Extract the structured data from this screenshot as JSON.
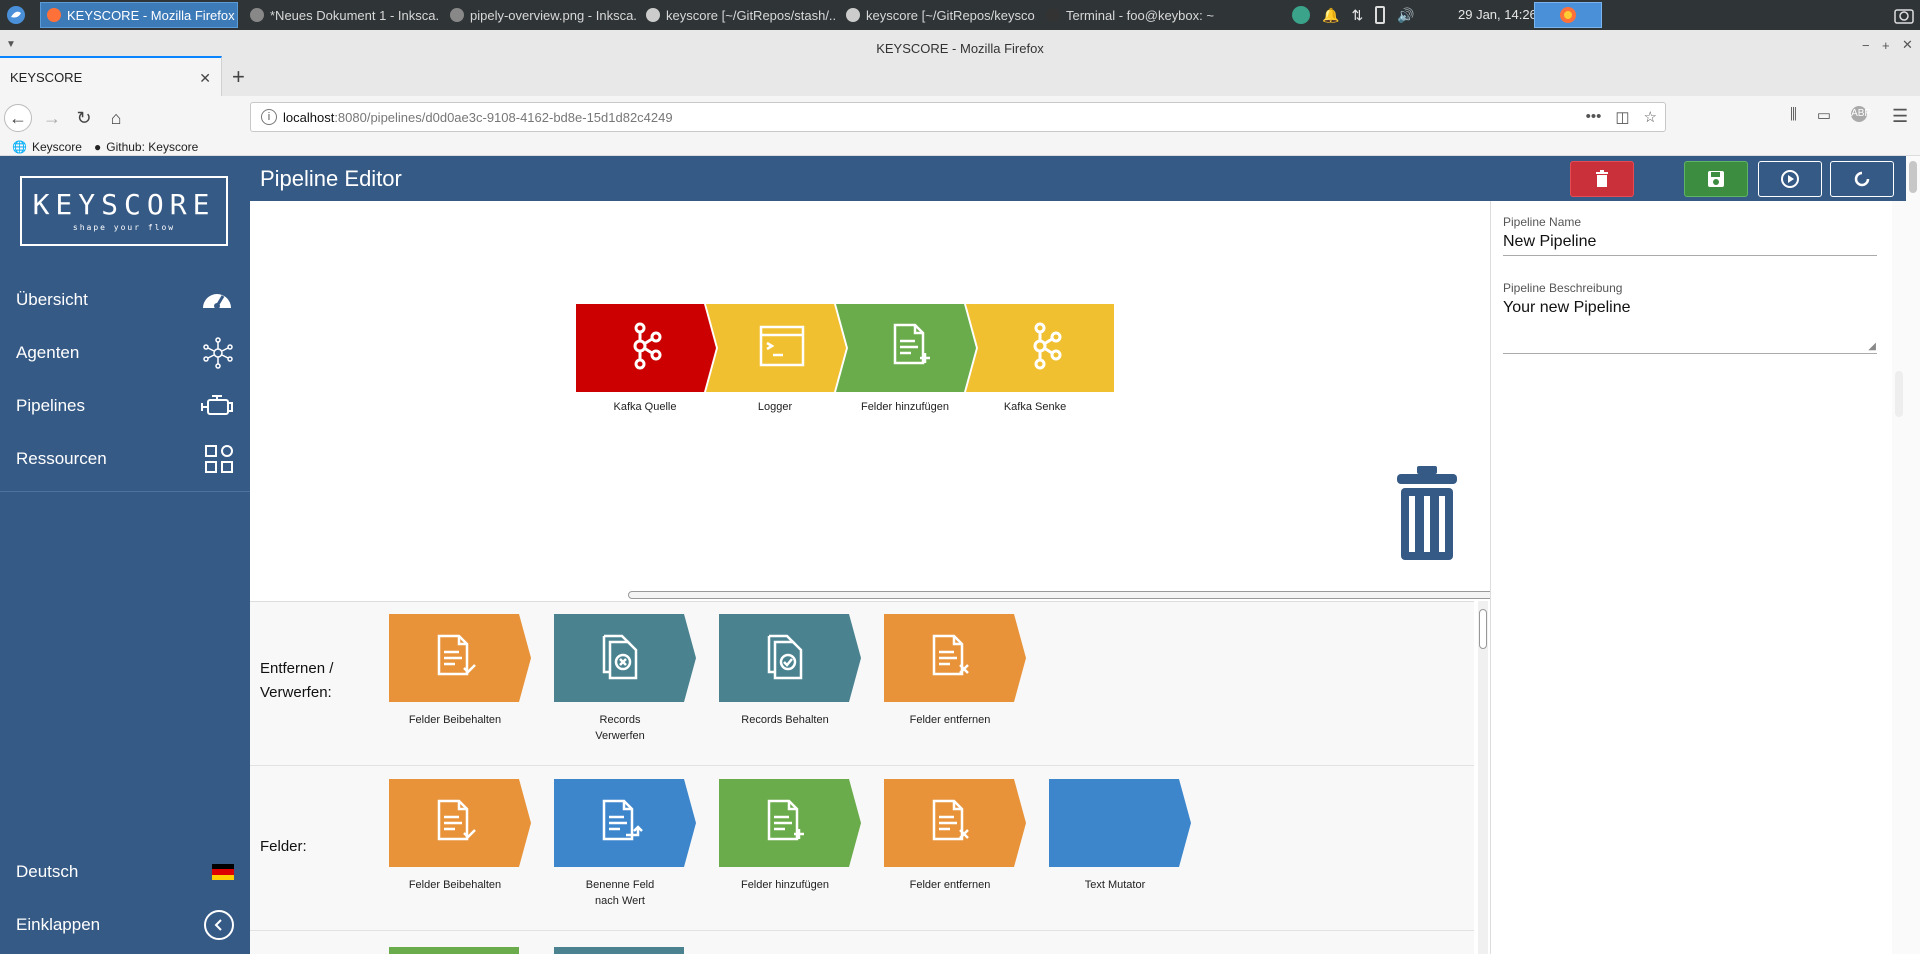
{
  "taskbar": {
    "windows": [
      {
        "label": "KEYSCORE - Mozilla Firefox",
        "active": true
      },
      {
        "label": "*Neues Dokument 1 - Inksca...",
        "active": false
      },
      {
        "label": "pipely-overview.png - Inksca...",
        "active": false
      },
      {
        "label": "keyscore [~/GitRepos/stash/...",
        "active": false
      },
      {
        "label": "keyscore [~/GitRepos/keysco...",
        "active": false
      },
      {
        "label": "Terminal - foo@keybox: ~",
        "active": false
      }
    ],
    "clock": "29 Jan, 14:26"
  },
  "browser": {
    "window_title": "KEYSCORE - Mozilla Firefox",
    "tab_title": "KEYSCORE",
    "url_host": "localhost",
    "url_rest": ":8080/pipelines/d0d0ae3c-9108-4162-bd8e-15d1d82c4249",
    "bookmarks": [
      "Keyscore",
      "Github: Keyscore"
    ]
  },
  "sidebar": {
    "logo_title": "KEYSCORE",
    "logo_sub": "shape your flow",
    "items": [
      {
        "label": "Übersicht",
        "icon": "dashboard-icon"
      },
      {
        "label": "Agenten",
        "icon": "network-icon"
      },
      {
        "label": "Pipelines",
        "icon": "engine-icon"
      },
      {
        "label": "Ressourcen",
        "icon": "resources-icon"
      }
    ],
    "language": "Deutsch",
    "collapse": "Einklappen"
  },
  "header": {
    "title": "Pipeline Editor"
  },
  "pipeline": {
    "blocks": [
      {
        "label": "Kafka Quelle",
        "color": "#cc0000",
        "icon": "kafka-icon"
      },
      {
        "label": "Logger",
        "color": "#f0c030",
        "icon": "terminal-icon"
      },
      {
        "label": "Felder hinzufügen",
        "color": "#6aab4b",
        "icon": "add-fields-icon"
      },
      {
        "label": "Kafka Senke",
        "color": "#f0c030",
        "icon": "kafka-icon"
      }
    ]
  },
  "palette": {
    "categories": [
      {
        "title_line1": "Entfernen /",
        "title_line2": "Verwerfen:",
        "tiles": [
          {
            "label1": "Felder Beibehalten",
            "label2": "",
            "color": "#e8923a",
            "icon": "retain-fields-icon"
          },
          {
            "label1": "Records",
            "label2": "Verwerfen",
            "color": "#4a8290",
            "icon": "discard-records-icon"
          },
          {
            "label1": "Records Behalten",
            "label2": "",
            "color": "#4a8290",
            "icon": "retain-records-icon"
          },
          {
            "label1": "Felder entfernen",
            "label2": "",
            "color": "#e8923a",
            "icon": "remove-fields-icon"
          }
        ]
      },
      {
        "title_line1": "Felder:",
        "title_line2": "",
        "tiles": [
          {
            "label1": "Felder Beibehalten",
            "label2": "",
            "color": "#e8923a",
            "icon": "retain-fields-icon"
          },
          {
            "label1": "Benenne Feld",
            "label2": "nach Wert",
            "color": "#3d86cc",
            "icon": "rename-field-icon"
          },
          {
            "label1": "Felder hinzufügen",
            "label2": "",
            "color": "#6aab4b",
            "icon": "add-fields-icon"
          },
          {
            "label1": "Felder entfernen",
            "label2": "",
            "color": "#e8923a",
            "icon": "remove-fields-icon"
          },
          {
            "label1": "Text Mutator",
            "label2": "",
            "color": "#3d86cc",
            "icon": ""
          }
        ]
      }
    ],
    "peek_colors": [
      "#6aab4b",
      "#4a8290"
    ]
  },
  "properties": {
    "name_label": "Pipeline Name",
    "name_value": "New Pipeline",
    "desc_label": "Pipeline Beschreibung",
    "desc_value": "Your new Pipeline"
  }
}
